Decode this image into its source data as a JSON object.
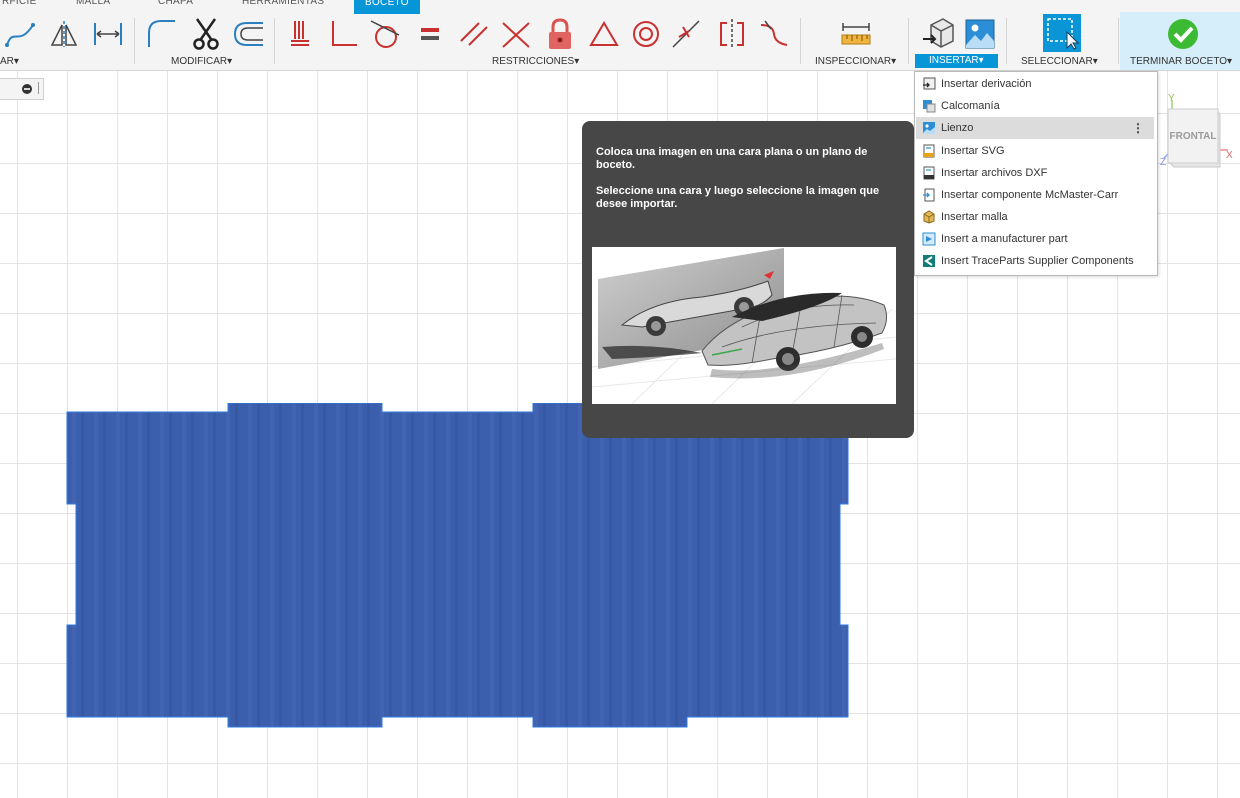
{
  "tabs": [
    "RFICIE",
    "MALLA",
    "CHAPA",
    "HERRAMIENTAS",
    "BOCETO"
  ],
  "groups": {
    "crear": "AR",
    "modificar": "MODIFICAR",
    "restricciones": "RESTRICCIONES",
    "inspeccionar": "INSPECCIONAR",
    "insertar": "INSERTAR",
    "seleccionar": "SELECCIONAR",
    "terminar": "TERMINAR BOCETO"
  },
  "dropdown_caret": "▾",
  "tooltip": {
    "line1": "Coloca una imagen en una cara plana o un plano de",
    "line2": "boceto.",
    "line3": "Seleccione una cara y luego seleccione la imagen que",
    "line4": "desee importar."
  },
  "insert_menu": [
    {
      "label": "Insertar derivación",
      "icon": "derive-icon"
    },
    {
      "label": "Calcomanía",
      "icon": "decal-icon"
    },
    {
      "label": "Lienzo",
      "icon": "canvas-icon"
    },
    {
      "label": "Insertar SVG",
      "icon": "svg-file-icon"
    },
    {
      "label": "Insertar archivos DXF",
      "icon": "dxf-file-icon"
    },
    {
      "label": "Insertar componente McMaster-Carr",
      "icon": "mcmaster-icon"
    },
    {
      "label": "Insertar malla",
      "icon": "mesh-icon"
    },
    {
      "label": "Insert a manufacturer part",
      "icon": "manufacturer-part-icon"
    },
    {
      "label": "Insert TraceParts Supplier Components",
      "icon": "traceparts-icon"
    }
  ],
  "highlighted_item": "Lienzo",
  "more_options": "⋮",
  "viewcube": {
    "face": "FRONTAL",
    "axis_y": "Y",
    "axis_x": "X",
    "axis_z": "Z"
  },
  "colors": {
    "accent": "#0696d7",
    "profile_fill": "#3b5fad",
    "tooltip_bg": "#474747",
    "constraint_red": "#c8312f",
    "finish_green": "#3dba34"
  }
}
